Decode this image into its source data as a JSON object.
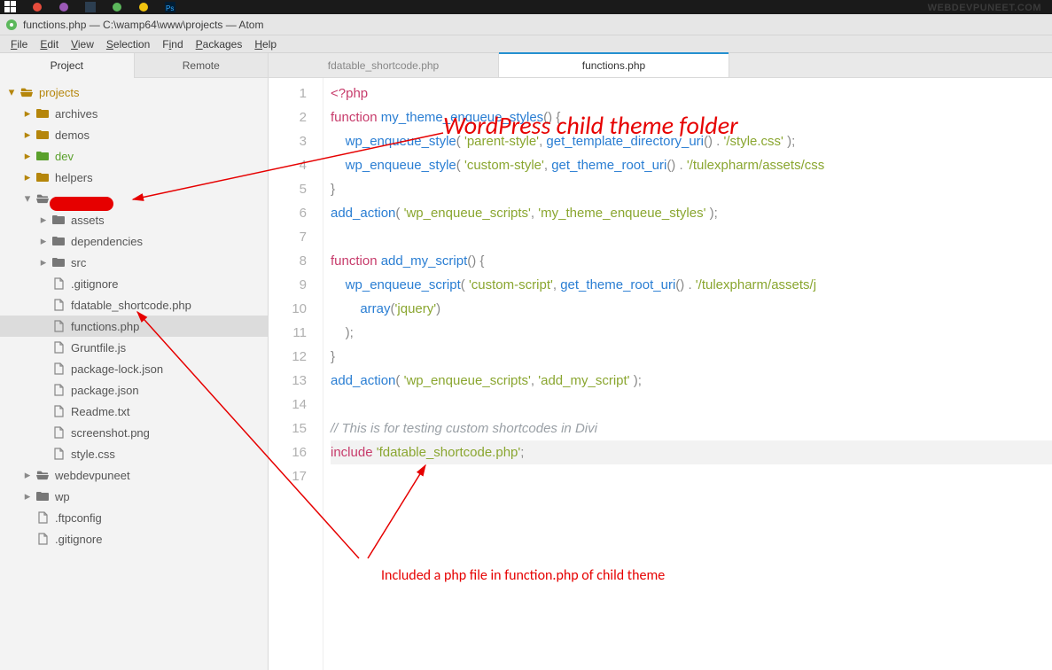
{
  "site_label": "WEBDEVPUNEET.COM",
  "window_title": "functions.php — C:\\wamp64\\www\\projects — Atom",
  "menu": [
    "File",
    "Edit",
    "View",
    "Selection",
    "Find",
    "Packages",
    "Help"
  ],
  "panel_tabs": {
    "project": "Project",
    "remote": "Remote"
  },
  "tree": {
    "root": "projects",
    "level1": [
      {
        "name": "archives",
        "type": "folder",
        "color": "gold"
      },
      {
        "name": "demos",
        "type": "folder",
        "color": "gold"
      },
      {
        "name": "dev",
        "type": "folder",
        "color": "green"
      },
      {
        "name": "helpers",
        "type": "folder",
        "color": "gold"
      }
    ],
    "redacted_folder_children": [
      {
        "name": "assets",
        "type": "folder-grey"
      },
      {
        "name": "dependencies",
        "type": "folder-grey"
      },
      {
        "name": "src",
        "type": "folder-grey"
      },
      {
        "name": ".gitignore",
        "type": "file"
      },
      {
        "name": "fdatable_shortcode.php",
        "type": "file"
      },
      {
        "name": "functions.php",
        "type": "file",
        "selected": true
      },
      {
        "name": "Gruntfile.js",
        "type": "file"
      },
      {
        "name": "package-lock.json",
        "type": "file"
      },
      {
        "name": "package.json",
        "type": "file"
      },
      {
        "name": "Readme.txt",
        "type": "file"
      },
      {
        "name": "screenshot.png",
        "type": "file"
      },
      {
        "name": "style.css",
        "type": "file"
      }
    ],
    "level1b": [
      {
        "name": "webdevpuneet",
        "type": "folder-grey"
      },
      {
        "name": "wp",
        "type": "folder-grey"
      },
      {
        "name": ".ftpconfig",
        "type": "file"
      },
      {
        "name": ".gitignore",
        "type": "file"
      }
    ]
  },
  "editor_tabs": [
    {
      "label": "fdatable_shortcode.php",
      "active": false
    },
    {
      "label": "functions.php",
      "active": true
    }
  ],
  "annotations": {
    "top": "WordPress child theme folder",
    "bottom": "Included a php file in function.php of child theme"
  },
  "code_lines": {
    "l1_open": "<?php",
    "l2_kw": "function",
    "l2_fn": "my_theme_enqueue_styles",
    "l2_rest": "() {",
    "l3_call": "wp_enqueue_style",
    "l3_s1": "'parent-style'",
    "l3_call2": "get_template_directory_uri",
    "l3_s2": "'/style.css'",
    "l4_call": "wp_enqueue_style",
    "l4_s1": "'custom-style'",
    "l4_call2": "get_theme_root_uri",
    "l4_s2": "'/tulexpharm/assets/css",
    "l5": "}",
    "l6_call": "add_action",
    "l6_s1": "'wp_enqueue_scripts'",
    "l6_s2": "'my_theme_enqueue_styles'",
    "l8_kw": "function",
    "l8_fn": "add_my_script",
    "l8_rest": "() {",
    "l9_call": "wp_enqueue_script",
    "l9_s1": "'custom-script'",
    "l9_call2": "get_theme_root_uri",
    "l9_s2": "'/tulexpharm/assets/j",
    "l10_call": "array",
    "l10_s1": "'jquery'",
    "l11": ");",
    "l12": "}",
    "l13_call": "add_action",
    "l13_s1": "'wp_enqueue_scripts'",
    "l13_s2": "'add_my_script'",
    "l15_cmt": "// This is for testing custom shortcodes in Divi",
    "l16_kw": "include",
    "l16_s": "'fdatable_shortcode.php'"
  },
  "line_count": 17
}
